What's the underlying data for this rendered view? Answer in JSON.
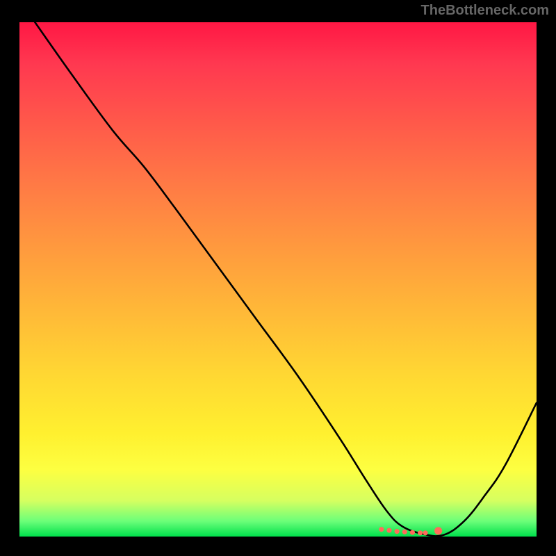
{
  "watermark": "TheBottleneck.com",
  "chart_data": {
    "type": "line",
    "title": "",
    "xlabel": "",
    "ylabel": "",
    "xlim": [
      0,
      100
    ],
    "ylim": [
      0,
      100
    ],
    "series": [
      {
        "name": "curve",
        "x": [
          3,
          10,
          18,
          24,
          30,
          38,
          46,
          54,
          62,
          67,
          71,
          74,
          78,
          82,
          86,
          90,
          94,
          100
        ],
        "y": [
          100,
          90,
          79,
          72,
          64,
          53,
          42,
          31,
          19,
          11,
          5,
          2,
          0.5,
          0.3,
          3,
          8,
          14,
          26
        ]
      }
    ],
    "markers": {
      "name": "valley-points",
      "x": [
        70,
        71.5,
        73,
        74.5,
        76,
        77.5,
        78.5,
        81
      ],
      "y": [
        1.4,
        1.2,
        1.0,
        0.9,
        0.8,
        0.7,
        0.7,
        1.1
      ]
    },
    "gradient_stops": [
      {
        "pos": 0.0,
        "color": "#ff1744"
      },
      {
        "pos": 0.2,
        "color": "#ff5a4a"
      },
      {
        "pos": 0.44,
        "color": "#ff9a3e"
      },
      {
        "pos": 0.68,
        "color": "#ffd633"
      },
      {
        "pos": 0.87,
        "color": "#fdff41"
      },
      {
        "pos": 1.0,
        "color": "#00e04c"
      }
    ]
  }
}
